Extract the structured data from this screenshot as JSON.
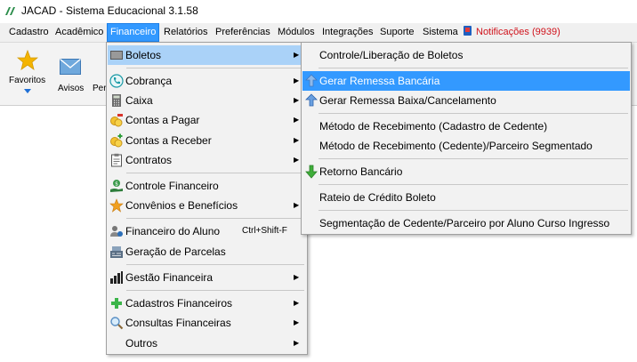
{
  "window": {
    "title": "JACAD - Sistema Educacional 3.1.58"
  },
  "menubar": {
    "items": [
      "Cadastro",
      "Acadêmico",
      "Financeiro",
      "Relatórios",
      "Preferências",
      "Módulos",
      "Integrações",
      "Suporte",
      "Sistema"
    ],
    "active": "Financeiro",
    "notifications": "Notificações (9939)"
  },
  "toolbar": {
    "favoritos": "Favoritos",
    "avisos": "Avisos",
    "partial": "Per"
  },
  "financeiro_menu": {
    "items": [
      {
        "label": "Boletos",
        "icon": "boleto-icon",
        "submenu": true,
        "highlighted": true
      },
      {
        "label": "Cobrança",
        "icon": "phone-icon",
        "submenu": true
      },
      {
        "label": "Caixa",
        "icon": "calculator-icon",
        "submenu": true
      },
      {
        "label": "Contas a Pagar",
        "icon": "coins-minus-icon",
        "submenu": true
      },
      {
        "label": "Contas a Receber",
        "icon": "coins-plus-icon",
        "submenu": true
      },
      {
        "label": "Contratos",
        "icon": "clipboard-icon",
        "submenu": true
      },
      {
        "label": "Controle Financeiro",
        "icon": "money-hand-icon"
      },
      {
        "label": "Convênios e Benefícios",
        "icon": "star-icon",
        "submenu": true
      },
      {
        "label": "Financeiro do Aluno",
        "icon": "student-money-icon",
        "shortcut": "Ctrl+Shift-F"
      },
      {
        "label": "Geração de Parcelas",
        "icon": "cash-register-icon"
      },
      {
        "label": "Gestão Financeira",
        "icon": "bar-chart-icon",
        "submenu": true
      },
      {
        "label": "Cadastros Financeiros",
        "icon": "green-plus-icon",
        "submenu": true
      },
      {
        "label": "Consultas Financeiras",
        "icon": "magnifier-icon",
        "submenu": true
      },
      {
        "label": "Outros",
        "icon": "",
        "submenu": true
      }
    ]
  },
  "boletos_submenu": {
    "items": [
      {
        "label": "Controle/Liberação de Boletos",
        "icon": ""
      },
      {
        "label": "Gerar Remessa Bancária",
        "icon": "upload-arrow-icon",
        "highlighted": true
      },
      {
        "label": "Gerar Remessa Baixa/Cancelamento",
        "icon": "upload-arrow-icon"
      },
      {
        "label": "Método de Recebimento (Cadastro de Cedente)",
        "icon": ""
      },
      {
        "label": "Método de Recebimento (Cedente)/Parceiro Segmentado",
        "icon": ""
      },
      {
        "label": "Retorno Bancário",
        "icon": "download-arrow-icon"
      },
      {
        "label": "Rateio de Crédito Boleto",
        "icon": ""
      },
      {
        "label": "Segmentação de Cedente/Parceiro por Aluno Curso Ingresso",
        "icon": ""
      }
    ]
  },
  "colors": {
    "menu_highlight": "#3399ff",
    "item_highlight": "#aad2f8",
    "notification": "#d0121b",
    "menu_bg": "#f2f2f2"
  }
}
